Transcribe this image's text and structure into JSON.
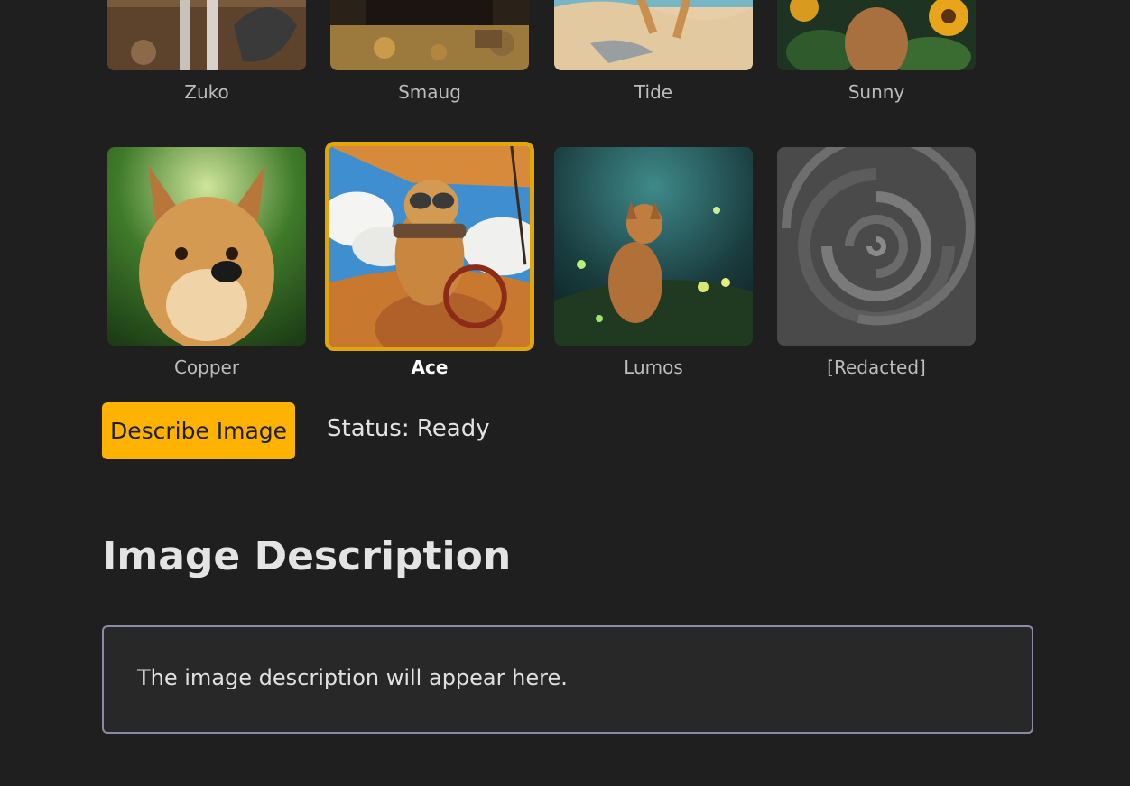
{
  "gallery": {
    "row1": [
      {
        "name": "Zuko"
      },
      {
        "name": "Smaug"
      },
      {
        "name": "Tide"
      },
      {
        "name": "Sunny"
      }
    ],
    "row2": [
      {
        "name": "Copper"
      },
      {
        "name": "Ace",
        "selected": true
      },
      {
        "name": "Lumos"
      },
      {
        "name": "[Redacted]"
      }
    ]
  },
  "actions": {
    "describe_label": "Describe Image",
    "status_text": "Status: Ready"
  },
  "description": {
    "heading": "Image Description",
    "placeholder_text": "The image description will appear here."
  },
  "colors": {
    "background": "#1f1f1f",
    "accent": "#ffb300",
    "selected_border": "#e0a60c",
    "box_border": "#8b8ba8"
  }
}
